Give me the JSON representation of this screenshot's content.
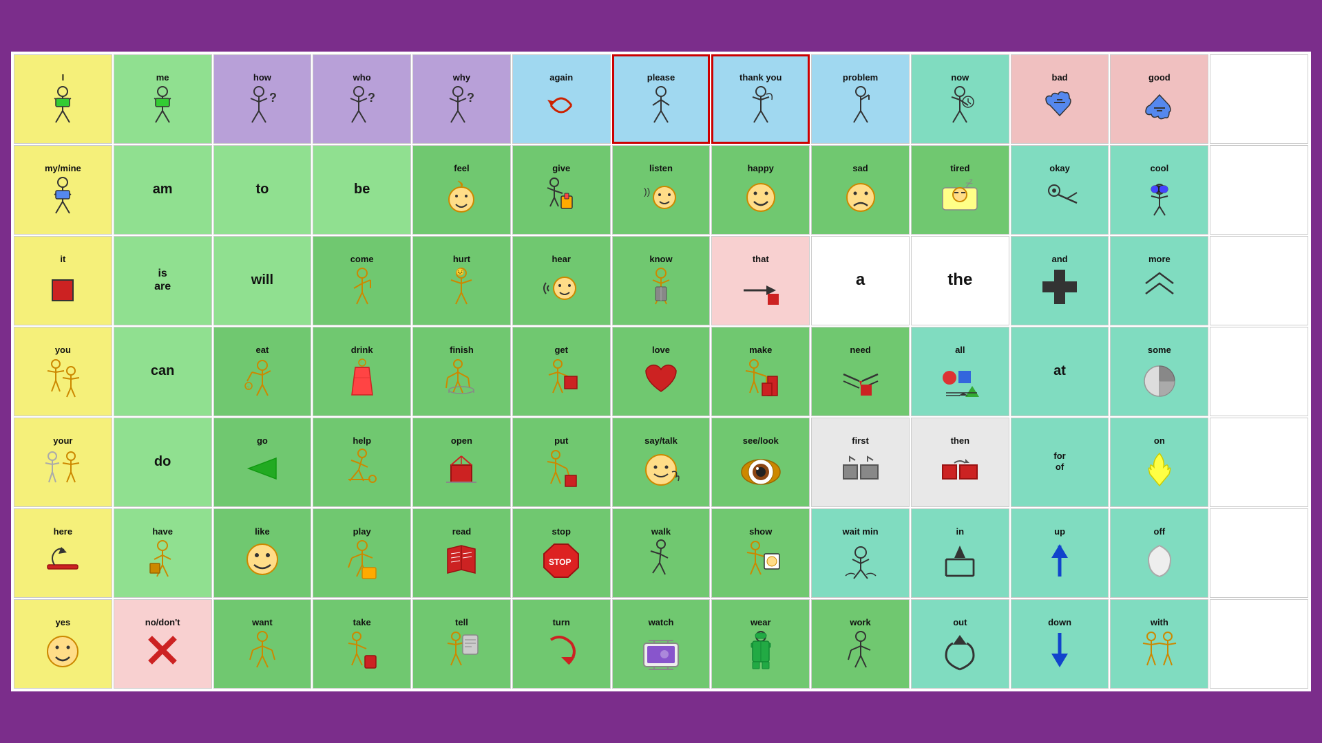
{
  "cells": [
    {
      "label": "I",
      "icon": "🧍",
      "bg": "bg-yellow",
      "row": 0,
      "col": 0
    },
    {
      "label": "me",
      "icon": "🧍",
      "bg": "bg-green",
      "row": 0,
      "col": 1
    },
    {
      "label": "how",
      "icon": "🤔",
      "bg": "bg-purple",
      "row": 0,
      "col": 2
    },
    {
      "label": "who",
      "icon": "🤷",
      "bg": "bg-purple",
      "row": 0,
      "col": 3
    },
    {
      "label": "why",
      "icon": "🤷",
      "bg": "bg-purple",
      "row": 0,
      "col": 4
    },
    {
      "label": "again",
      "icon": "↩️",
      "bg": "bg-blue-light",
      "row": 0,
      "col": 5
    },
    {
      "label": "please",
      "icon": "🙏",
      "bg": "bg-blue-light",
      "border": "border-red",
      "row": 0,
      "col": 6
    },
    {
      "label": "thank you",
      "icon": "📞",
      "bg": "bg-blue-light",
      "border": "border-red",
      "row": 0,
      "col": 7
    },
    {
      "label": "problem",
      "icon": "🤦",
      "bg": "bg-blue-light",
      "row": 0,
      "col": 8
    },
    {
      "label": "now",
      "icon": "⏰",
      "bg": "bg-teal",
      "row": 0,
      "col": 9
    },
    {
      "label": "bad",
      "icon": "👎",
      "bg": "bg-pink",
      "row": 0,
      "col": 10
    },
    {
      "label": "good",
      "icon": "👍",
      "bg": "bg-pink",
      "row": 0,
      "col": 11
    },
    {
      "label": "",
      "icon": "",
      "bg": "bg-white",
      "row": 0,
      "col": 12
    },
    {
      "label": "my/mine",
      "icon": "🧍",
      "bg": "bg-yellow",
      "row": 1,
      "col": 0
    },
    {
      "label": "am",
      "icon": "",
      "bg": "bg-green",
      "row": 1,
      "col": 1
    },
    {
      "label": "to",
      "icon": "",
      "bg": "bg-green",
      "row": 1,
      "col": 2
    },
    {
      "label": "be",
      "icon": "",
      "bg": "bg-green",
      "row": 1,
      "col": 3
    },
    {
      "label": "feel",
      "icon": "😊",
      "bg": "bg-green2",
      "row": 1,
      "col": 4
    },
    {
      "label": "give",
      "icon": "🎁",
      "bg": "bg-green2",
      "row": 1,
      "col": 5
    },
    {
      "label": "listen",
      "icon": "👂",
      "bg": "bg-green2",
      "row": 1,
      "col": 6
    },
    {
      "label": "happy",
      "icon": "😊",
      "bg": "bg-green2",
      "row": 1,
      "col": 7
    },
    {
      "label": "sad",
      "icon": "😢",
      "bg": "bg-green2",
      "row": 1,
      "col": 8
    },
    {
      "label": "tired",
      "icon": "😴",
      "bg": "bg-green2",
      "row": 1,
      "col": 9
    },
    {
      "label": "okay",
      "icon": "👌",
      "bg": "bg-teal",
      "row": 1,
      "col": 10
    },
    {
      "label": "cool",
      "icon": "😎",
      "bg": "bg-teal",
      "row": 1,
      "col": 11
    },
    {
      "label": "",
      "icon": "",
      "bg": "bg-white",
      "row": 1,
      "col": 12
    },
    {
      "label": "it",
      "icon": "🟥",
      "bg": "bg-yellow",
      "row": 2,
      "col": 0
    },
    {
      "label": "is\nare",
      "icon": "",
      "bg": "bg-green",
      "row": 2,
      "col": 1
    },
    {
      "label": "will",
      "icon": "",
      "bg": "bg-green",
      "row": 2,
      "col": 2
    },
    {
      "label": "come",
      "icon": "🧍",
      "bg": "bg-green2",
      "row": 2,
      "col": 3
    },
    {
      "label": "hurt",
      "icon": "😣",
      "bg": "bg-green2",
      "row": 2,
      "col": 4
    },
    {
      "label": "hear",
      "icon": "👂",
      "bg": "bg-green2",
      "row": 2,
      "col": 5
    },
    {
      "label": "know",
      "icon": "🧠",
      "bg": "bg-green2",
      "row": 2,
      "col": 6
    },
    {
      "label": "that",
      "icon": "👉🟥",
      "bg": "bg-pink2",
      "row": 2,
      "col": 7
    },
    {
      "label": "a",
      "icon": "",
      "bg": "bg-white",
      "row": 2,
      "col": 8
    },
    {
      "label": "the",
      "icon": "",
      "bg": "bg-white",
      "row": 2,
      "col": 9
    },
    {
      "label": "and",
      "icon": "➕",
      "bg": "bg-teal",
      "row": 2,
      "col": 10
    },
    {
      "label": "more",
      "icon": "🙌",
      "bg": "bg-teal",
      "row": 2,
      "col": 11
    },
    {
      "label": "",
      "icon": "",
      "bg": "bg-white",
      "row": 2,
      "col": 12
    },
    {
      "label": "you",
      "icon": "🧍🧍",
      "bg": "bg-yellow",
      "row": 3,
      "col": 0
    },
    {
      "label": "can",
      "icon": "",
      "bg": "bg-green",
      "row": 3,
      "col": 1
    },
    {
      "label": "eat",
      "icon": "🍽️",
      "bg": "bg-green2",
      "row": 3,
      "col": 2
    },
    {
      "label": "drink",
      "icon": "🥤",
      "bg": "bg-green2",
      "row": 3,
      "col": 3
    },
    {
      "label": "finish",
      "icon": "🏁",
      "bg": "bg-green2",
      "row": 3,
      "col": 4
    },
    {
      "label": "get",
      "icon": "📦",
      "bg": "bg-green2",
      "row": 3,
      "col": 5
    },
    {
      "label": "love",
      "icon": "❤️",
      "bg": "bg-green2",
      "row": 3,
      "col": 6
    },
    {
      "label": "make",
      "icon": "🔨",
      "bg": "bg-green2",
      "row": 3,
      "col": 7
    },
    {
      "label": "need",
      "icon": "🤲",
      "bg": "bg-green2",
      "row": 3,
      "col": 8
    },
    {
      "label": "all",
      "icon": "🔵🟦🔺",
      "bg": "bg-teal",
      "row": 3,
      "col": 9
    },
    {
      "label": "at",
      "icon": "",
      "bg": "bg-teal",
      "row": 3,
      "col": 10
    },
    {
      "label": "some",
      "icon": "🥧",
      "bg": "bg-teal",
      "row": 3,
      "col": 11
    },
    {
      "label": "",
      "icon": "",
      "bg": "bg-white",
      "row": 3,
      "col": 12
    },
    {
      "label": "your",
      "icon": "🧍🧍",
      "bg": "bg-yellow",
      "row": 4,
      "col": 0
    },
    {
      "label": "do",
      "icon": "",
      "bg": "bg-green",
      "row": 4,
      "col": 1
    },
    {
      "label": "go",
      "icon": "➡️",
      "bg": "bg-green2",
      "row": 4,
      "col": 2
    },
    {
      "label": "help",
      "icon": "🧍",
      "bg": "bg-green2",
      "row": 4,
      "col": 3
    },
    {
      "label": "open",
      "icon": "📂",
      "bg": "bg-green2",
      "row": 4,
      "col": 4
    },
    {
      "label": "put",
      "icon": "📦",
      "bg": "bg-green2",
      "row": 4,
      "col": 5
    },
    {
      "label": "say/talk",
      "icon": "😊",
      "bg": "bg-green2",
      "row": 4,
      "col": 6
    },
    {
      "label": "see/look",
      "icon": "👁️",
      "bg": "bg-green2",
      "row": 4,
      "col": 7
    },
    {
      "label": "first",
      "icon": "⬛⬛",
      "bg": "bg-gray",
      "row": 4,
      "col": 8
    },
    {
      "label": "then",
      "icon": "⬛⬛",
      "bg": "bg-gray",
      "row": 4,
      "col": 9
    },
    {
      "label": "for\nof",
      "icon": "",
      "bg": "bg-teal",
      "row": 4,
      "col": 10
    },
    {
      "label": "on",
      "icon": "💡",
      "bg": "bg-teal",
      "row": 4,
      "col": 11
    },
    {
      "label": "",
      "icon": "",
      "bg": "bg-white",
      "row": 4,
      "col": 12
    },
    {
      "label": "here",
      "icon": "📍",
      "bg": "bg-yellow",
      "row": 5,
      "col": 0
    },
    {
      "label": "have",
      "icon": "🧍",
      "bg": "bg-green",
      "row": 5,
      "col": 1
    },
    {
      "label": "like",
      "icon": "😊",
      "bg": "bg-green2",
      "row": 5,
      "col": 2
    },
    {
      "label": "play",
      "icon": "🎲",
      "bg": "bg-green2",
      "row": 5,
      "col": 3
    },
    {
      "label": "read",
      "icon": "📖",
      "bg": "bg-green2",
      "row": 5,
      "col": 4
    },
    {
      "label": "stop",
      "icon": "🛑",
      "bg": "bg-green2",
      "row": 5,
      "col": 5
    },
    {
      "label": "walk",
      "icon": "🚶",
      "bg": "bg-green2",
      "row": 5,
      "col": 6
    },
    {
      "label": "show",
      "icon": "🖼️",
      "bg": "bg-green2",
      "row": 5,
      "col": 7
    },
    {
      "label": "wait min",
      "icon": "🙌",
      "bg": "bg-teal",
      "row": 5,
      "col": 8
    },
    {
      "label": "in",
      "icon": "⬜",
      "bg": "bg-teal",
      "row": 5,
      "col": 9
    },
    {
      "label": "up",
      "icon": "⬆️",
      "bg": "bg-teal",
      "row": 5,
      "col": 10
    },
    {
      "label": "off",
      "icon": "💡",
      "bg": "bg-teal",
      "row": 5,
      "col": 11
    },
    {
      "label": "",
      "icon": "",
      "bg": "bg-white",
      "row": 5,
      "col": 12
    },
    {
      "label": "yes",
      "icon": "😊",
      "bg": "bg-yellow",
      "row": 6,
      "col": 0
    },
    {
      "label": "no/don't",
      "icon": "❌",
      "bg": "bg-pink2",
      "row": 6,
      "col": 1
    },
    {
      "label": "want",
      "icon": "🧍",
      "bg": "bg-green2",
      "row": 6,
      "col": 2
    },
    {
      "label": "take",
      "icon": "🧍📦",
      "bg": "bg-green2",
      "row": 6,
      "col": 3
    },
    {
      "label": "tell",
      "icon": "🏙️",
      "bg": "bg-green2",
      "row": 6,
      "col": 4
    },
    {
      "label": "turn",
      "icon": "↪️",
      "bg": "bg-green2",
      "row": 6,
      "col": 5
    },
    {
      "label": "watch",
      "icon": "📺",
      "bg": "bg-green2",
      "row": 6,
      "col": 6
    },
    {
      "label": "wear",
      "icon": "👷",
      "bg": "bg-green2",
      "row": 6,
      "col": 7
    },
    {
      "label": "work",
      "icon": "🧍",
      "bg": "bg-green2",
      "row": 6,
      "col": 8
    },
    {
      "label": "out",
      "icon": "↩️",
      "bg": "bg-teal",
      "row": 6,
      "col": 9
    },
    {
      "label": "down",
      "icon": "⬇️",
      "bg": "bg-teal",
      "row": 6,
      "col": 10
    },
    {
      "label": "with",
      "icon": "🧍🧍",
      "bg": "bg-teal",
      "row": 6,
      "col": 11
    },
    {
      "label": "",
      "icon": "",
      "bg": "bg-white",
      "row": 6,
      "col": 12
    }
  ]
}
